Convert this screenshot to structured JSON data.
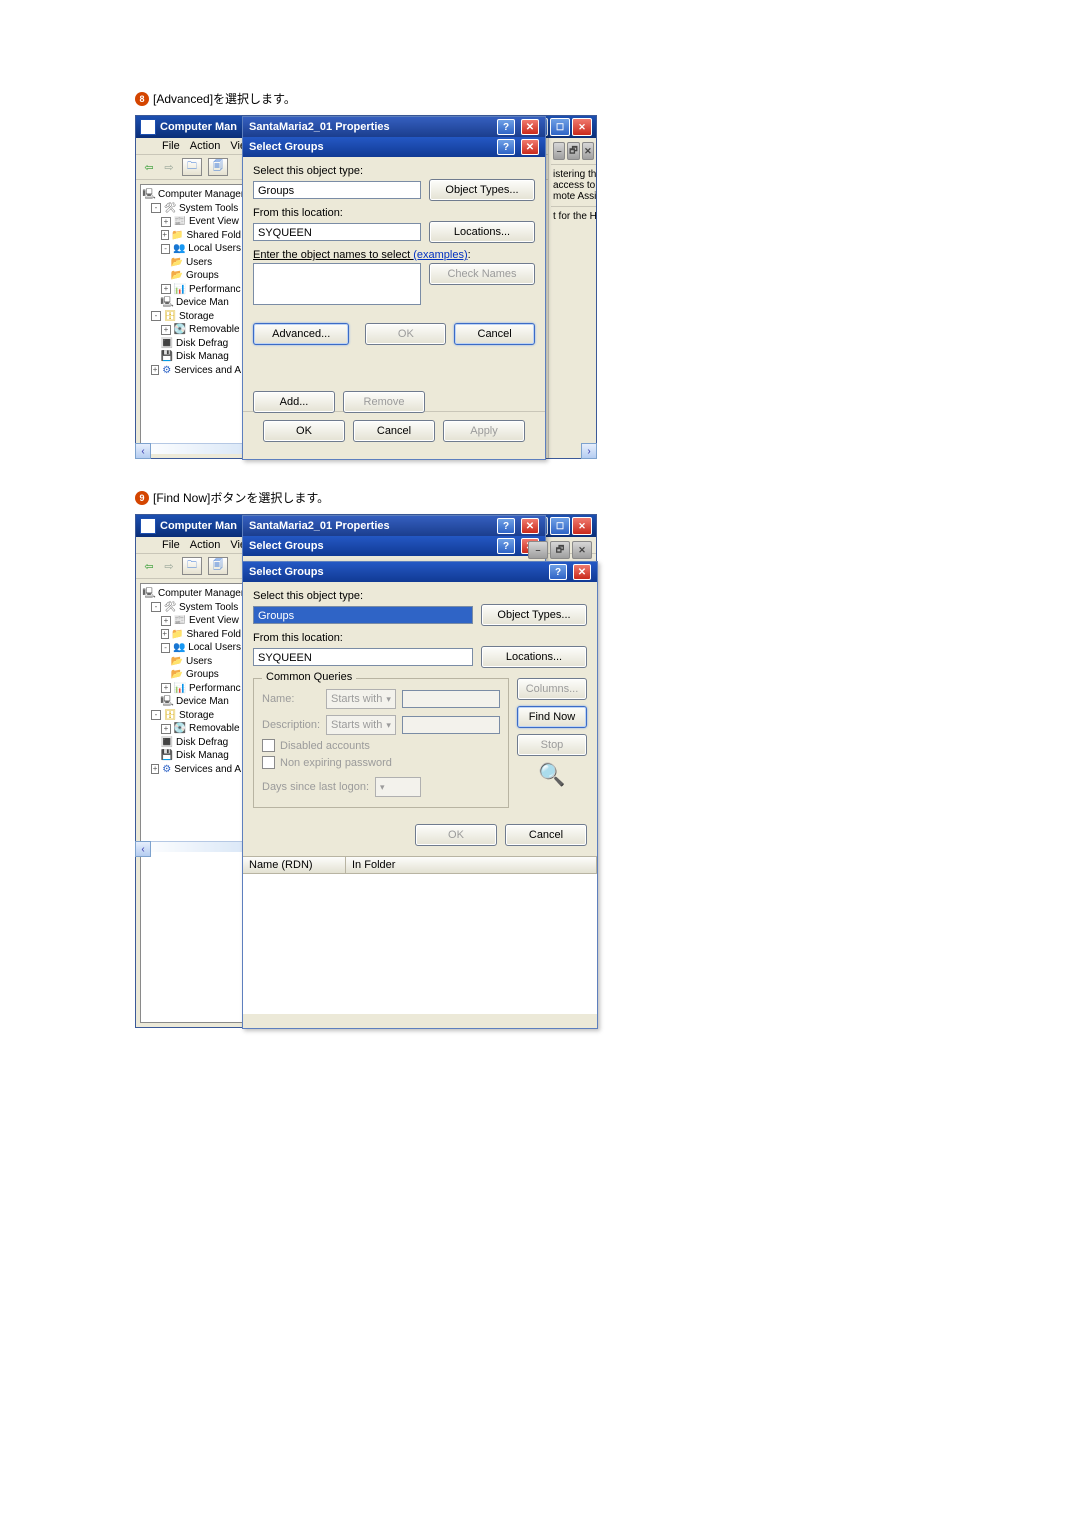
{
  "step8": {
    "num": "8",
    "title": "[Advanced]を選択します。"
  },
  "step9": {
    "num": "9",
    "title": "[Find Now]ボタンを選択します。"
  },
  "mmc": {
    "app_title": "Computer Man",
    "menu": {
      "file": "File",
      "action": "Action",
      "view": "Vie"
    },
    "tree": {
      "root": "Computer Managem",
      "system_tools": "System Tools",
      "event_viewer": "Event View",
      "shared_folders": "Shared Fold",
      "local_users": "Local Users",
      "users": "Users",
      "groups": "Groups",
      "performance": "Performanc",
      "device_mgr": "Device Man",
      "storage": "Storage",
      "removable": "Removable",
      "defrag": "Disk Defrag",
      "diskmgmt": "Disk Manag",
      "services": "Services and A"
    }
  },
  "right_strip": {
    "line1": "istering th",
    "line2": "access to",
    "line3": "mote Assis",
    "line4": "t for the H"
  },
  "props_title": "SantaMaria2_01 Properties",
  "select_groups": {
    "title": "Select Groups",
    "obj_type_label": "Select this object type:",
    "obj_type_value": "Groups",
    "obj_types_btn": "Object Types...",
    "loc_label": "From this location:",
    "loc_value": "SYQUEEN",
    "loc_btn": "Locations...",
    "names_label_a": "Enter the object names to select ",
    "names_label_b": "(examples)",
    "check_btn": "Check Names",
    "advanced_btn": "Advanced...",
    "ok": "OK",
    "cancel": "Cancel",
    "add": "Add...",
    "remove": "Remove",
    "apply": "Apply"
  },
  "advanced": {
    "title": "Select Groups",
    "columns_btn": "Columns...",
    "findnow_btn": "Find Now",
    "stop_btn": "Stop",
    "common": "Common Queries",
    "name_label": "Name:",
    "desc_label": "Description:",
    "starts_with": "Starts with",
    "disabled": "Disabled accounts",
    "nonexp": "Non expiring password",
    "days": "Days since last logon:",
    "col_name": "Name (RDN)",
    "col_folder": "In Folder"
  }
}
